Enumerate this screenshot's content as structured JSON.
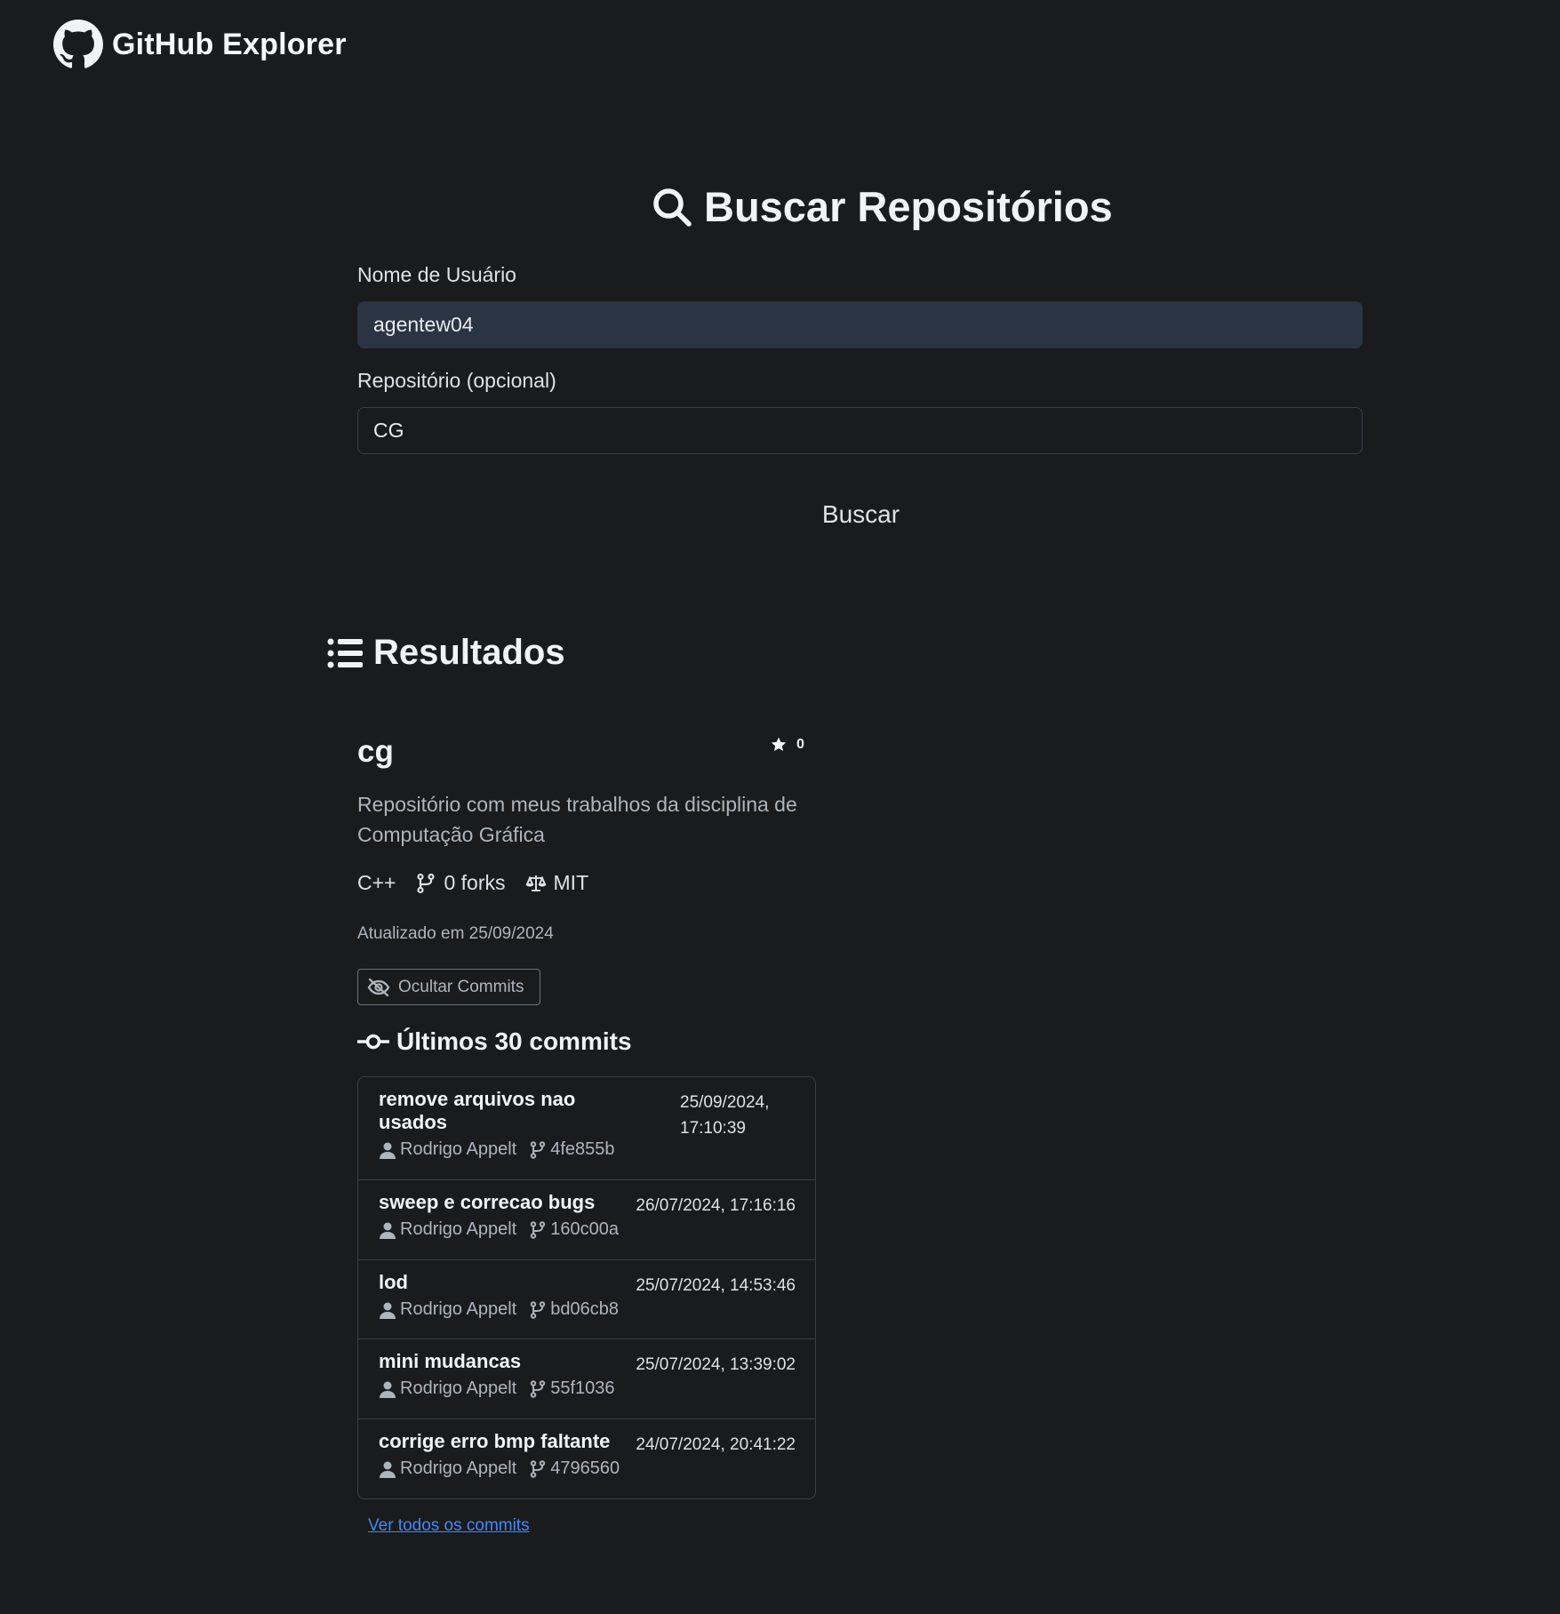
{
  "navbar": {
    "title": "GitHub Explorer"
  },
  "search": {
    "title": "Buscar Repositórios",
    "username_label": "Nome de Usuário",
    "username_value": "agentew04",
    "repo_label": "Repositório (opcional)",
    "repo_value": "CG",
    "button_label": "Buscar"
  },
  "results": {
    "title": "Resultados",
    "repo": {
      "name": "cg",
      "stars": "0",
      "description": "Repositório com meus trabalhos da disciplina de Computação Gráfica",
      "language": "C++",
      "forks": "0 forks",
      "license": "MIT",
      "updated": "Atualizado em 25/09/2024",
      "hide_commits_label": "Ocultar Commits",
      "commits_title": "Últimos 30 commits",
      "commits": [
        {
          "message": "remove arquivos nao usados",
          "author": "Rodrigo Appelt",
          "sha": "4fe855b",
          "date": "25/09/2024, 17:10:39"
        },
        {
          "message": "sweep e correcao bugs",
          "author": "Rodrigo Appelt",
          "sha": "160c00a",
          "date": "26/07/2024, 17:16:16"
        },
        {
          "message": "lod",
          "author": "Rodrigo Appelt",
          "sha": "bd06cb8",
          "date": "25/07/2024, 14:53:46"
        },
        {
          "message": "mini mudancas",
          "author": "Rodrigo Appelt",
          "sha": "55f1036",
          "date": "25/07/2024, 13:39:02"
        },
        {
          "message": "corrige erro bmp faltante",
          "author": "Rodrigo Appelt",
          "sha": "4796560",
          "date": "24/07/2024, 20:41:22"
        }
      ],
      "view_all_label": "Ver todos os commits"
    }
  },
  "colors": {
    "background": "#1a1b1d",
    "input_filled": "#2b3442",
    "link": "#3d8bfd"
  }
}
